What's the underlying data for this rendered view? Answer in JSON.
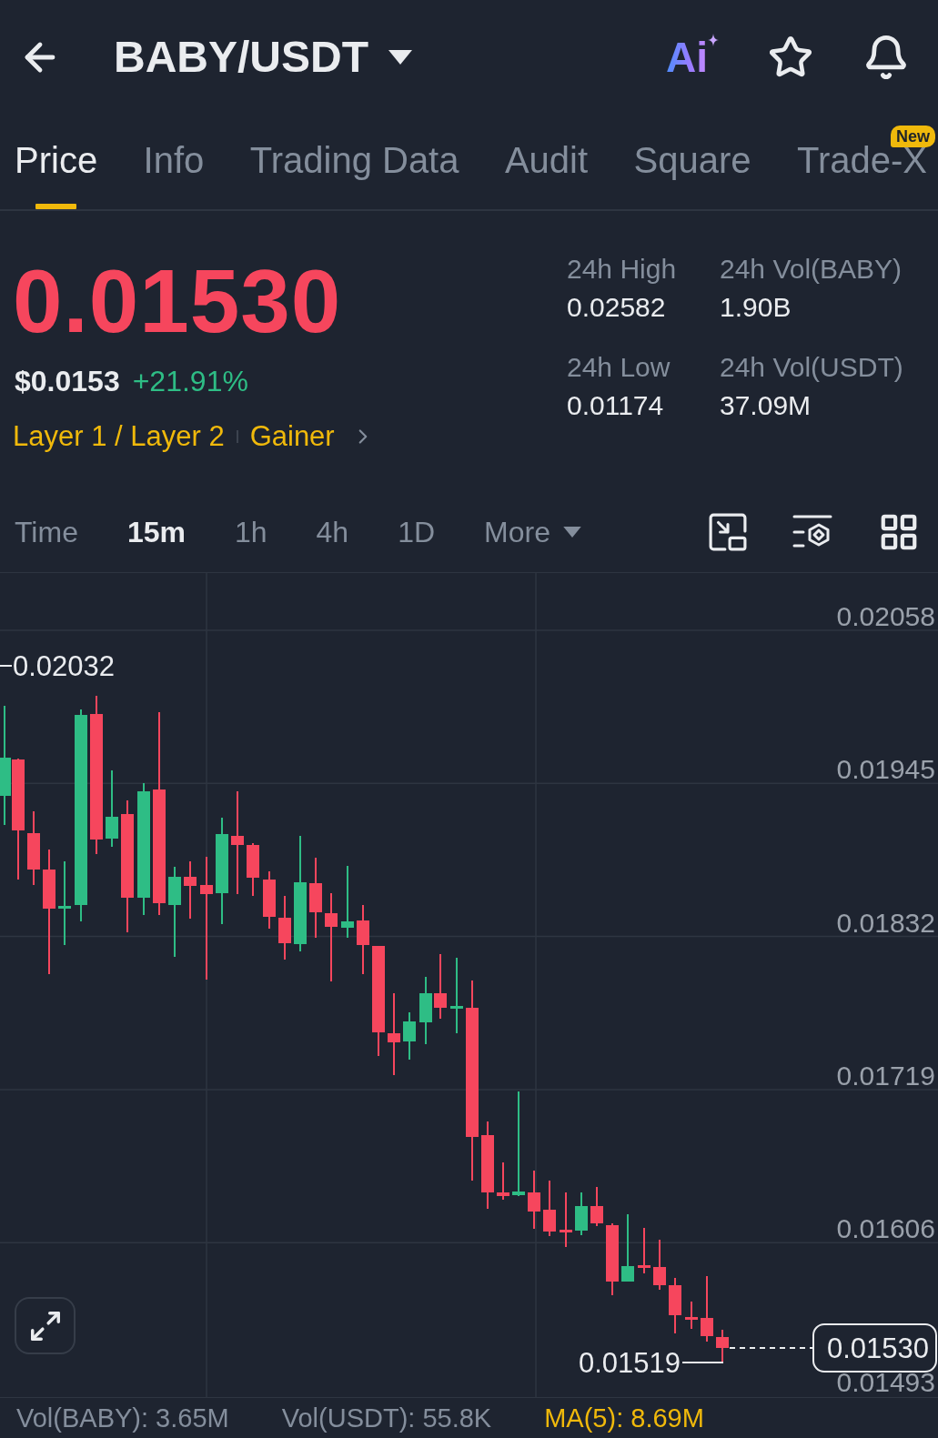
{
  "header": {
    "title": "BABY/USDT",
    "ai_label": "Ai"
  },
  "tabs": [
    {
      "label": "Price",
      "selected": true
    },
    {
      "label": "Info",
      "selected": false
    },
    {
      "label": "Trading Data",
      "selected": false
    },
    {
      "label": "Audit",
      "selected": false
    },
    {
      "label": "Square",
      "selected": false
    },
    {
      "label": "Trade-X",
      "selected": false,
      "badge": "New"
    }
  ],
  "ticker": {
    "price": "0.01530",
    "usd_price": "$0.0153",
    "change": "+21.91%",
    "tags": [
      "Layer 1 / Layer 2",
      "Gainer"
    ]
  },
  "stats": [
    {
      "label": "24h High",
      "value": "0.02582"
    },
    {
      "label": "24h Vol(BABY)",
      "value": "1.90B"
    },
    {
      "label": "24h Low",
      "value": "0.01174"
    },
    {
      "label": "24h Vol(USDT)",
      "value": "37.09M"
    }
  ],
  "intervals": [
    {
      "label": "Time",
      "selected": false,
      "kind": "option"
    },
    {
      "label": "15m",
      "selected": true,
      "kind": "option"
    },
    {
      "label": "1h",
      "selected": false,
      "kind": "option"
    },
    {
      "label": "4h",
      "selected": false,
      "kind": "option"
    },
    {
      "label": "1D",
      "selected": false,
      "kind": "option"
    },
    {
      "label": "More",
      "selected": false,
      "kind": "dropdown"
    }
  ],
  "chart": {
    "axis_labels": [
      "0.02058",
      "0.01945",
      "0.01832",
      "0.01719",
      "0.01606",
      "0.01493"
    ],
    "high_marker": "0.02032",
    "low_marker": "0.01519",
    "last_price": "0.01530"
  },
  "footer": [
    {
      "label": "Vol(BABY): 3.65M",
      "color": "#848e9c"
    },
    {
      "label": "Vol(USDT): 55.8K",
      "color": "#848e9c"
    },
    {
      "label": "MA(5): 8.69M",
      "color": "#f0b90b"
    }
  ]
}
